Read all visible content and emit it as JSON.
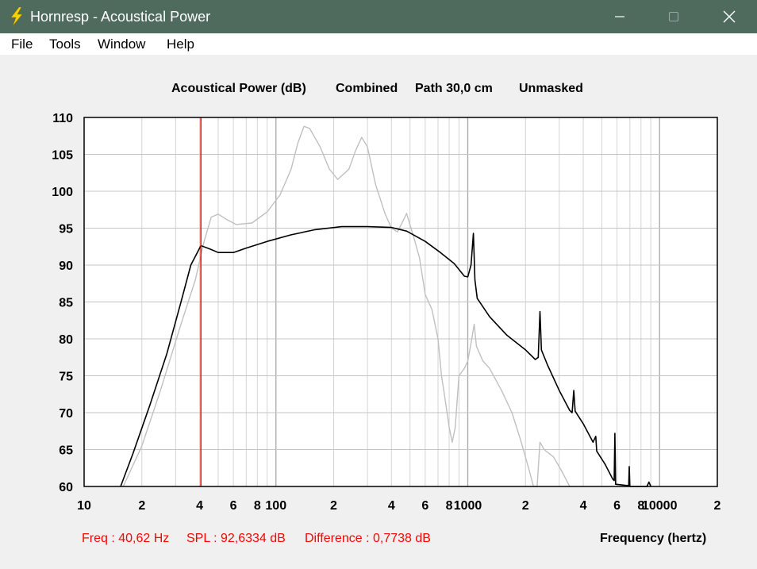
{
  "window": {
    "title": "Hornresp - Acoustical Power",
    "minimize_icon": "minimize-icon",
    "maximize_icon": "maximize-icon",
    "close_icon": "close-icon",
    "app_icon": "lightning-bolt-icon",
    "colors": {
      "titlebar": "#4f6b5e",
      "background": "#f0f0f0"
    }
  },
  "menu": {
    "items": [
      {
        "label": "File"
      },
      {
        "label": "Tools"
      },
      {
        "label": "Window"
      },
      {
        "label": "Help"
      }
    ]
  },
  "chart_header": {
    "part1": "Acoustical Power (dB)",
    "part2": "Combined",
    "part3": "Path 30,0 cm",
    "part4": "Unmasked"
  },
  "status": {
    "freq": "Freq : 40,62 Hz",
    "spl": "SPL : 92,6334 dB",
    "difference": "Difference : 0,7738 dB"
  },
  "chart_data": {
    "type": "line",
    "xscale": "log",
    "xlim": [
      10,
      20000
    ],
    "ylim": [
      60,
      110
    ],
    "xlabel": "Frequency (hertz)",
    "ylabel": "",
    "grid": true,
    "y_ticks": [
      110,
      105,
      100,
      95,
      90,
      85,
      80,
      75,
      70,
      65,
      60
    ],
    "x_ticks": [
      {
        "value": 10,
        "label": "10"
      },
      {
        "value": 20,
        "label": "2"
      },
      {
        "value": 40,
        "label": "4"
      },
      {
        "value": 60,
        "label": "6"
      },
      {
        "value": 80,
        "label": "8"
      },
      {
        "value": 100,
        "label": "100"
      },
      {
        "value": 200,
        "label": "2"
      },
      {
        "value": 400,
        "label": "4"
      },
      {
        "value": 600,
        "label": "6"
      },
      {
        "value": 800,
        "label": "8"
      },
      {
        "value": 1000,
        "label": "1000"
      },
      {
        "value": 2000,
        "label": "2"
      },
      {
        "value": 4000,
        "label": "4"
      },
      {
        "value": 6000,
        "label": "6"
      },
      {
        "value": 8000,
        "label": "8"
      },
      {
        "value": 10000,
        "label": "10000"
      },
      {
        "value": 20000,
        "label": "2"
      }
    ],
    "cursor_freq": 40.62,
    "colors": {
      "black_series": "#000000",
      "grey_series": "#c0c0c0",
      "cursor": "#ff0000",
      "grid": "#d4d4d4"
    },
    "series": [
      {
        "color": "#000000",
        "points": [
          [
            15.5,
            60
          ],
          [
            18,
            64.5
          ],
          [
            22,
            71
          ],
          [
            27,
            78
          ],
          [
            32,
            85
          ],
          [
            36,
            90
          ],
          [
            40.62,
            92.63
          ],
          [
            45,
            92.2
          ],
          [
            50,
            91.7
          ],
          [
            60,
            91.7
          ],
          [
            70,
            92.3
          ],
          [
            90,
            93.2
          ],
          [
            120,
            94.1
          ],
          [
            160,
            94.8
          ],
          [
            220,
            95.2
          ],
          [
            300,
            95.2
          ],
          [
            400,
            95.1
          ],
          [
            480,
            94.6
          ],
          [
            600,
            93.2
          ],
          [
            720,
            91.7
          ],
          [
            850,
            90.2
          ],
          [
            960,
            88.5
          ],
          [
            1000,
            88.4
          ],
          [
            1040,
            90
          ],
          [
            1070,
            94.3
          ],
          [
            1090,
            88
          ],
          [
            1120,
            85.5
          ],
          [
            1300,
            83
          ],
          [
            1600,
            80.5
          ],
          [
            2000,
            78.5
          ],
          [
            2250,
            77.2
          ],
          [
            2330,
            77.5
          ],
          [
            2380,
            83.7
          ],
          [
            2420,
            78.5
          ],
          [
            2600,
            76.5
          ],
          [
            3000,
            73
          ],
          [
            3400,
            70.3
          ],
          [
            3500,
            70
          ],
          [
            3570,
            73
          ],
          [
            3630,
            70.2
          ],
          [
            4000,
            68.5
          ],
          [
            4500,
            66
          ],
          [
            4650,
            66.8
          ],
          [
            4700,
            64.8
          ],
          [
            5200,
            63
          ],
          [
            5700,
            61
          ],
          [
            5800,
            60.8
          ],
          [
            5850,
            67.2
          ],
          [
            5900,
            60.3
          ],
          [
            6900,
            60.1
          ],
          [
            6950,
            62.7
          ],
          [
            7000,
            60
          ],
          [
            8600,
            60
          ],
          [
            8800,
            60.6
          ],
          [
            9000,
            60
          ]
        ]
      },
      {
        "color": "#c0c0c0",
        "points": [
          [
            16,
            60
          ],
          [
            20,
            65.5
          ],
          [
            25,
            73
          ],
          [
            32,
            82
          ],
          [
            38,
            88
          ],
          [
            42,
            93
          ],
          [
            46,
            96.5
          ],
          [
            50,
            96.9
          ],
          [
            55,
            96.2
          ],
          [
            62,
            95.5
          ],
          [
            75,
            95.7
          ],
          [
            90,
            97.2
          ],
          [
            105,
            99.5
          ],
          [
            120,
            103
          ],
          [
            130,
            106.5
          ],
          [
            140,
            108.8
          ],
          [
            150,
            108.5
          ],
          [
            170,
            106
          ],
          [
            190,
            103
          ],
          [
            210,
            101.6
          ],
          [
            240,
            103
          ],
          [
            260,
            105.5
          ],
          [
            280,
            107.3
          ],
          [
            300,
            106
          ],
          [
            330,
            101
          ],
          [
            370,
            97
          ],
          [
            400,
            95
          ],
          [
            430,
            94.5
          ],
          [
            460,
            96
          ],
          [
            480,
            97
          ],
          [
            520,
            94
          ],
          [
            560,
            91
          ],
          [
            600,
            86
          ],
          [
            650,
            84
          ],
          [
            700,
            80
          ],
          [
            730,
            75
          ],
          [
            750,
            73
          ],
          [
            800,
            68
          ],
          [
            830,
            66
          ],
          [
            860,
            68
          ],
          [
            900,
            75
          ],
          [
            960,
            76
          ],
          [
            1000,
            77
          ],
          [
            1050,
            80
          ],
          [
            1080,
            82
          ],
          [
            1110,
            79
          ],
          [
            1200,
            77
          ],
          [
            1300,
            76
          ],
          [
            1500,
            73
          ],
          [
            1700,
            70
          ],
          [
            1900,
            66
          ],
          [
            2100,
            62
          ],
          [
            2200,
            60
          ],
          [
            2300,
            60
          ],
          [
            2380,
            66
          ],
          [
            2500,
            65
          ],
          [
            2800,
            64
          ],
          [
            3100,
            62
          ],
          [
            3400,
            60
          ]
        ]
      }
    ]
  }
}
